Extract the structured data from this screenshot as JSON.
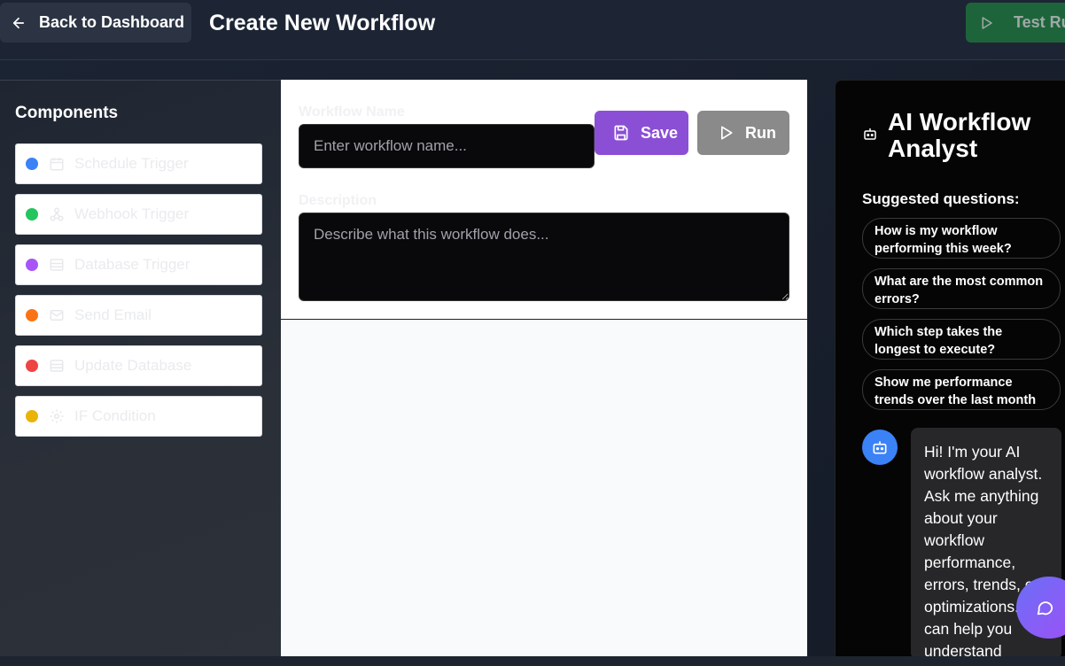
{
  "header": {
    "back_label": "Back to Dashboard",
    "title": "Create New Workflow",
    "test_label": "Test Ru"
  },
  "sidebar": {
    "title": "Components",
    "items": [
      {
        "label": "Schedule Trigger",
        "color": "#3b82f6",
        "icon": "calendar-icon"
      },
      {
        "label": "Webhook Trigger",
        "color": "#22c55e",
        "icon": "webhook-icon"
      },
      {
        "label": "Database Trigger",
        "color": "#a855f7",
        "icon": "database-icon"
      },
      {
        "label": "Send Email",
        "color": "#f97316",
        "icon": "mail-icon"
      },
      {
        "label": "Update Database",
        "color": "#ef4444",
        "icon": "database-icon"
      },
      {
        "label": "IF Condition",
        "color": "#eab308",
        "icon": "gear-icon"
      }
    ]
  },
  "form": {
    "name_label": "Workflow Name",
    "name_placeholder": "Enter workflow name...",
    "description_label": "Description",
    "description_placeholder": "Describe what this workflow does...",
    "save_label": "Save",
    "run_label": "Run"
  },
  "ai_panel": {
    "title": "AI Workflow Analyst",
    "suggested_title": "Suggested questions:",
    "questions": [
      "How is my workflow performing this week?",
      "What are the most common errors?",
      "Which step takes the longest to execute?",
      "Show me performance trends over the last month"
    ],
    "bot_message": "Hi! I'm your AI workflow analyst. Ask me anything about your workflow performance, errors, trends, or optimizations. I can help you understand"
  }
}
